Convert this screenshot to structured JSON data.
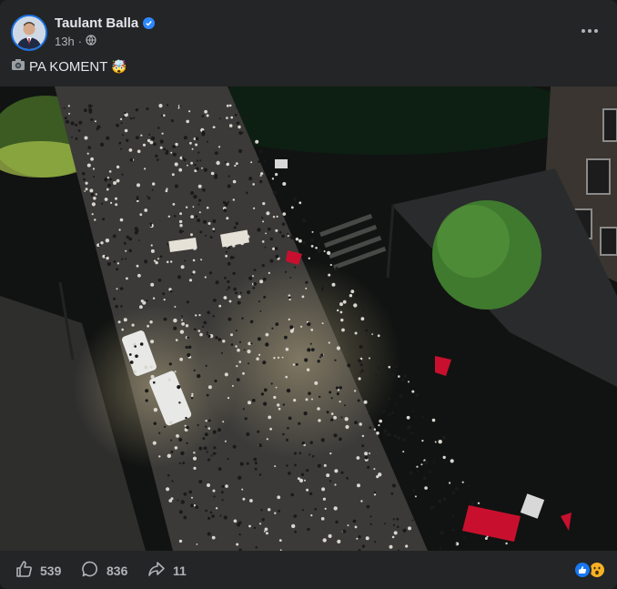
{
  "post": {
    "author": "Taulant Balla",
    "time": "13h",
    "privacy_icon": "globe-icon",
    "caption_prefix_icon": "camera-icon",
    "caption_text": "PA KOMENT",
    "caption_suffix_emoji": "🤯"
  },
  "stats": {
    "likes": "539",
    "comments": "836",
    "shares": "11"
  },
  "reactions": [
    "like-reaction-icon",
    "wow-reaction-icon"
  ],
  "colors": {
    "card_bg": "#242526",
    "text_primary": "#e4e6eb",
    "text_secondary": "#b0b3b8",
    "verified_blue": "#2d88ff",
    "like_blue": "#1877f2",
    "flag_red": "#c8102e"
  }
}
